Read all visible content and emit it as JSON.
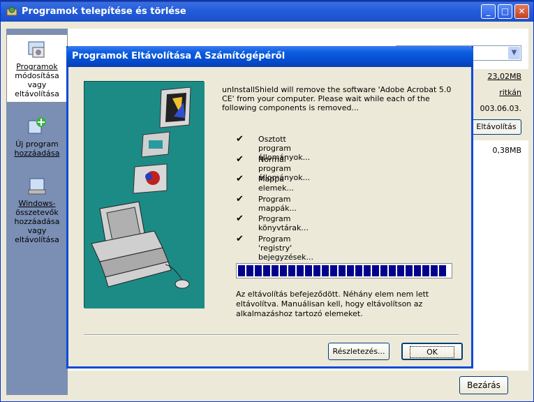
{
  "window": {
    "title": "Programok telepítése és törlése",
    "minimize_glyph": "_",
    "maximize_glyph": "□",
    "close_glyph": "✕"
  },
  "sidebar": {
    "items": [
      {
        "lines": [
          "Programok",
          "módosítása",
          "vagy eltávolítása"
        ],
        "icon": "change-remove-programs-icon"
      },
      {
        "lines": [
          "Új program",
          "hozzáadása"
        ],
        "icon": "add-program-icon"
      },
      {
        "lines": [
          "Windows-",
          "összetevők",
          "hozzáadása",
          "vagy",
          "eltávolítása"
        ],
        "icon": "windows-components-icon"
      }
    ]
  },
  "program_list": {
    "size_selected": "23,02MB",
    "usage": "ritkán",
    "last_used": "003.06.03.",
    "remove_label": "Eltávolítás",
    "size_other": "0,38MB"
  },
  "close_label": "Bezárás",
  "dialog": {
    "title": "Programok Eltávolítása A Számítógépéről",
    "intro": "unInstallShield will remove the software 'Adobe Acrobat 5.0 CE' from your computer.  Please wait while each of the following components is removed...",
    "check_glyph": "✔",
    "steps": [
      "Osztott program állományok...",
      "Normál program állományok...",
      "Mappa elemek...",
      "Program mappák...",
      "Program könyvtárak...",
      "Program 'registry' bejegyzések..."
    ],
    "progress_percent": 100,
    "message": "Az eltávolítás befejeződött. Néhány elem nem lett eltávolítva. Manuálisan kell, hogy eltávolítson az alkalmazáshoz tartozó elemeket.",
    "details_label": "Részletezés...",
    "ok_label": "OK"
  }
}
